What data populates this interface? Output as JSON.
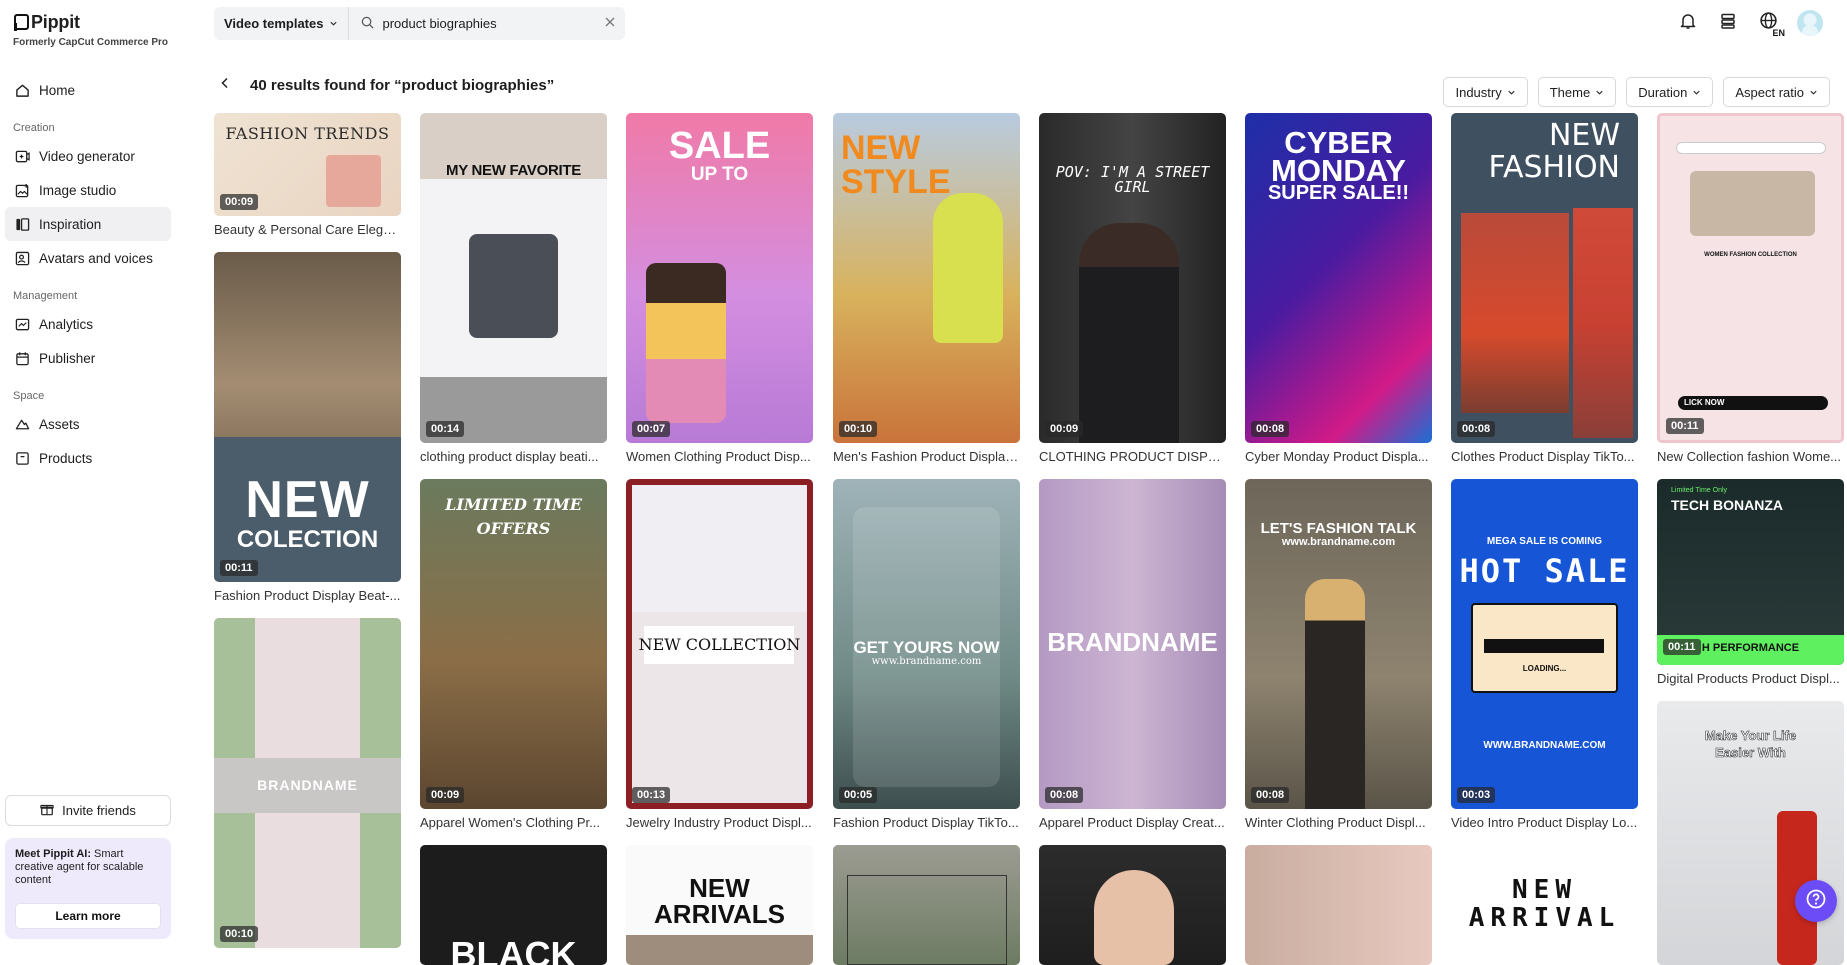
{
  "app": {
    "name": "Pippit",
    "subtitle": "Formerly CapCut Commerce Pro"
  },
  "sidebar": {
    "home": "Home",
    "sections": {
      "creation": "Creation",
      "management": "Management",
      "space": "Space"
    },
    "creation_items": [
      {
        "label": "Video generator",
        "icon": "video-plus-icon"
      },
      {
        "label": "Image studio",
        "icon": "image-plus-icon"
      },
      {
        "label": "Inspiration",
        "icon": "inspiration-icon",
        "active": true
      },
      {
        "label": "Avatars and voices",
        "icon": "avatar-icon"
      }
    ],
    "management_items": [
      {
        "label": "Analytics",
        "icon": "analytics-icon"
      },
      {
        "label": "Publisher",
        "icon": "calendar-icon"
      }
    ],
    "space_items": [
      {
        "label": "Assets",
        "icon": "cloud-icon"
      },
      {
        "label": "Products",
        "icon": "box-icon"
      }
    ],
    "invite": "Invite friends",
    "promo": {
      "title": "Meet Pippit AI:",
      "body": "Smart creative agent for scalable content",
      "button": "Learn more"
    }
  },
  "search": {
    "type": "Video templates",
    "query": "product biographies"
  },
  "results": {
    "title": "40 results found for “product biographies”"
  },
  "filters": [
    "Industry",
    "Theme",
    "Duration",
    "Aspect ratio"
  ],
  "topbar": {
    "lang": "EN"
  },
  "cards": [
    {
      "caption": "Beauty & Personal Care Elega...",
      "duration": "00:09",
      "headline": "FASHION TRENDS"
    },
    {
      "caption": "Fashion Product Display Beat-...",
      "duration": "00:11",
      "headline": "NEW",
      "headline2": "COLECTION"
    },
    {
      "caption": "",
      "duration": "00:10",
      "headline": "BRANDNAME"
    },
    {
      "caption": "clothing product display beati...",
      "duration": "00:14",
      "headline": "MY NEW FAVORITE"
    },
    {
      "caption": "Apparel Women's Clothing Pr...",
      "duration": "00:09",
      "headline": "LIMITED TIME",
      "headline2": "OFFERS"
    },
    {
      "caption": "",
      "duration": "",
      "headline": "BLACK"
    },
    {
      "caption": "Women Clothing Product Disp...",
      "duration": "00:07",
      "headline": "SALE",
      "headline2": "UP TO"
    },
    {
      "caption": "Jewelry Industry Product Displ...",
      "duration": "00:13",
      "headline": "NEW COLLECTION"
    },
    {
      "caption": "",
      "duration": "",
      "headline": "NEW",
      "headline2": "ARRIVALS"
    },
    {
      "caption": "Men's Fashion Product Display...",
      "duration": "00:10",
      "headline": "NEW",
      "headline2": "STYLE"
    },
    {
      "caption": "Fashion Product Display TikTo...",
      "duration": "00:05",
      "headline": "GET YOURS NOW",
      "headline2": "www.brandname.com"
    },
    {
      "caption": "",
      "duration": "",
      "headline": ""
    },
    {
      "caption": "CLOTHING PRODUCT DISPLAY",
      "duration": "00:09",
      "headline": "POV: I'M A STREET GIRL"
    },
    {
      "caption": "Apparel Product Display Creat...",
      "duration": "00:08",
      "headline": "BRANDNAME"
    },
    {
      "caption": "",
      "duration": "",
      "headline": ""
    },
    {
      "caption": "Cyber Monday Product Displa...",
      "duration": "00:08",
      "headline": "CYBER",
      "headline2": "MONDAY",
      "headline3": "SUPER SALE!!"
    },
    {
      "caption": "Winter Clothing Product Displ...",
      "duration": "00:08",
      "headline": "LET'S FASHION TALK",
      "headline2": "www.brandname.com"
    },
    {
      "caption": "",
      "duration": "",
      "headline": ""
    },
    {
      "caption": "Clothes Product Display TikTo...",
      "duration": "00:08",
      "headline": "NEW",
      "headline2": "FASHION"
    },
    {
      "caption": "Video Intro Product Display Lo...",
      "duration": "00:03",
      "headline": "MEGA SALE IS COMING",
      "headline2": "HOT SALE",
      "headline3": "LOADING...",
      "headline4": "WWW.BRANDNAME.COM"
    },
    {
      "caption": "",
      "duration": "",
      "headline": "NEW",
      "headline2": "ARRIVAL"
    },
    {
      "caption": "New Collection fashion Wome...",
      "duration": "00:11",
      "headline": "WOMEN FASHION COLLECTION",
      "headline2": "LICK NOW"
    },
    {
      "caption": "Digital Products Product Displ...",
      "duration": "00:11",
      "headline": "TECH BONANZA",
      "headline2": "Limited Time Only",
      "headline3": "H PERFORMANCE"
    },
    {
      "caption": "",
      "duration": "",
      "headline": "Make Your Life",
      "headline2": "Easier With"
    }
  ]
}
